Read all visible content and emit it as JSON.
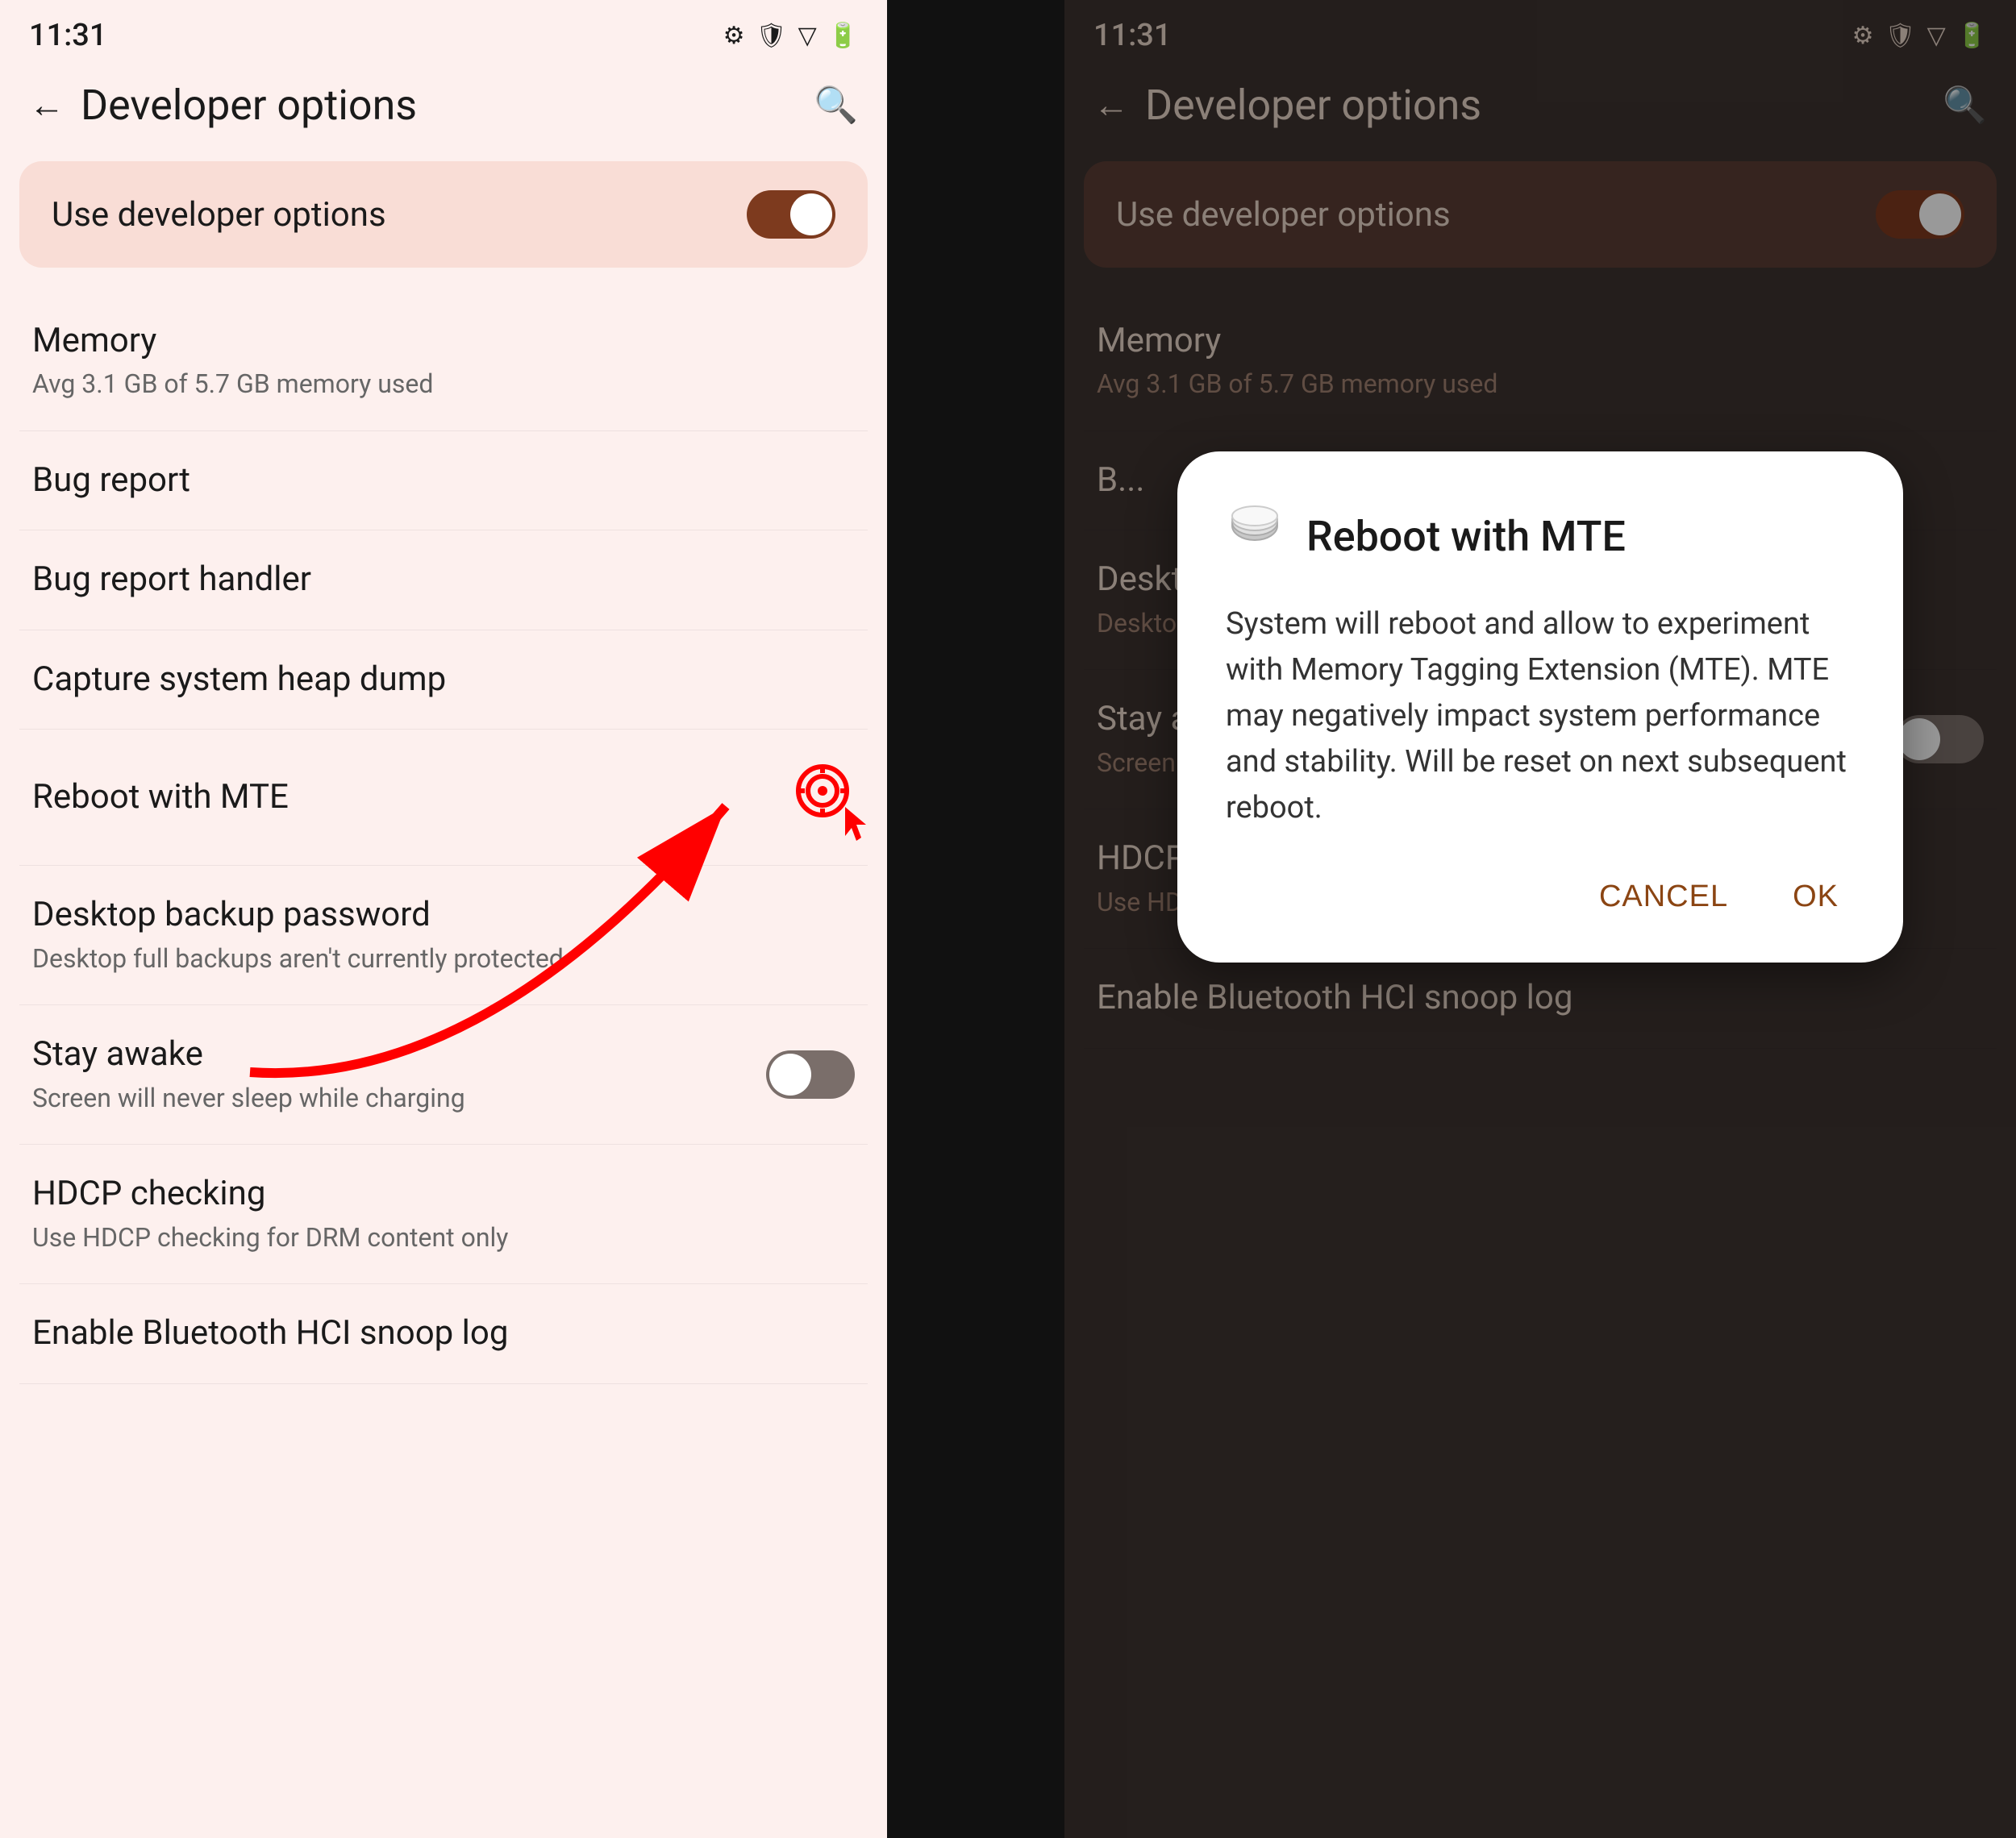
{
  "left": {
    "statusBar": {
      "time": "11:31",
      "batteryIcon": "🔋"
    },
    "nav": {
      "title": "Developer options",
      "backLabel": "←",
      "searchLabel": "🔍"
    },
    "devOptionsCard": {
      "label": "Use developer options",
      "toggleState": "on"
    },
    "items": [
      {
        "title": "Memory",
        "subtitle": "Avg 3.1 GB of 5.7 GB memory used",
        "hasToggle": false
      },
      {
        "title": "Bug report",
        "subtitle": "",
        "hasToggle": false
      },
      {
        "title": "Bug report handler",
        "subtitle": "",
        "hasToggle": false
      },
      {
        "title": "Capture system heap dump",
        "subtitle": "",
        "hasToggle": false
      },
      {
        "title": "Reboot with MTE",
        "subtitle": "",
        "hasToggle": false,
        "hasCursor": true
      },
      {
        "title": "Desktop backup password",
        "subtitle": "Desktop full backups aren't currently protected",
        "hasToggle": false
      },
      {
        "title": "Stay awake",
        "subtitle": "Screen will never sleep while charging",
        "hasToggle": true,
        "toggleState": "off"
      },
      {
        "title": "HDCP checking",
        "subtitle": "Use HDCP checking for DRM content only",
        "hasToggle": false
      },
      {
        "title": "Enable Bluetooth HCI snoop log",
        "subtitle": "",
        "hasToggle": false
      }
    ]
  },
  "right": {
    "statusBar": {
      "time": "11:31",
      "batteryIcon": "🔋"
    },
    "nav": {
      "title": "Developer options",
      "backLabel": "←",
      "searchLabel": "🔍"
    },
    "devOptionsCard": {
      "label": "Use developer options",
      "toggleState": "on"
    },
    "items": [
      {
        "title": "Memory",
        "subtitle": "Avg 3.1 GB of 5.7 GB memory used",
        "hasToggle": false
      },
      {
        "title": "Bug report",
        "subtitle": "",
        "hasToggle": false
      },
      {
        "title": "Desktop backup password",
        "subtitle": "Desktop full backups aren't currently protected",
        "hasToggle": false
      },
      {
        "title": "Stay awake",
        "subtitle": "Screen will never sleep while charging",
        "hasToggle": true,
        "toggleState": "off"
      },
      {
        "title": "HDCP checking",
        "subtitle": "Use HDCP checking for DRM content only",
        "hasToggle": false
      },
      {
        "title": "Enable Bluetooth HCI snoop log",
        "subtitle": "",
        "hasToggle": false
      }
    ],
    "dialog": {
      "title": "Reboot with MTE",
      "icon": "💿",
      "body": "System will reboot and allow to experiment with Memory Tagging Extension (MTE). MTE may negatively impact system performance and stability. Will be reset on next subsequent reboot.",
      "cancelLabel": "Cancel",
      "okLabel": "OK"
    }
  }
}
